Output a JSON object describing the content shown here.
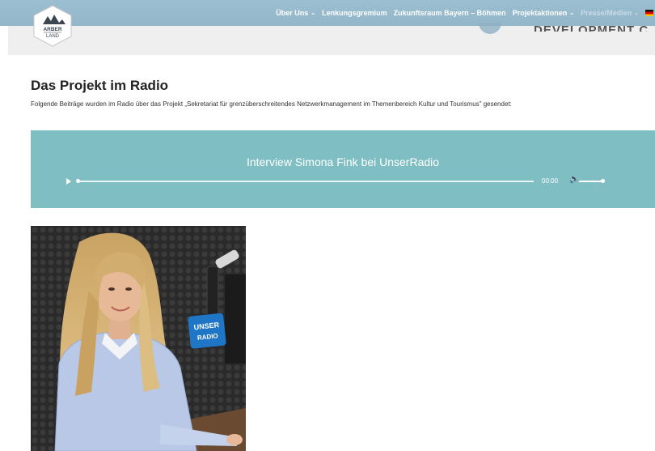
{
  "header": {
    "logo_text": "ARBER LAND",
    "nav": [
      {
        "label": "Über Uns",
        "has_dropdown": true
      },
      {
        "label": "Lenkungsgremium",
        "has_dropdown": false
      },
      {
        "label": "Zukunftsraum Bayern – Böhmen",
        "has_dropdown": false
      },
      {
        "label": "Projektaktionen",
        "has_dropdown": true
      },
      {
        "label": "Presse/Medien",
        "has_dropdown": true
      }
    ],
    "partial_banner_text": "DEVELOPMENT C"
  },
  "page": {
    "title": "Das Projekt im Radio",
    "intro": "Folgende Beiträge wurden im Radio über das Projekt „Sekretariat für grenzüberschreitendes Netzwerkmanagement im Themenbereich Kultur und Tourismus\" gesendet:"
  },
  "player": {
    "title": "Interview Simona Fink bei UnserRadio",
    "time": "00:00",
    "progress_fraction": 0.0,
    "volume_fraction": 0.9
  },
  "photo": {
    "badge_line1": "UNSER",
    "badge_line2": "RADIO"
  },
  "colors": {
    "nav_bg": "#9bbfd0",
    "player_bg": "#7fbfc4",
    "header_band": "#efefef"
  }
}
